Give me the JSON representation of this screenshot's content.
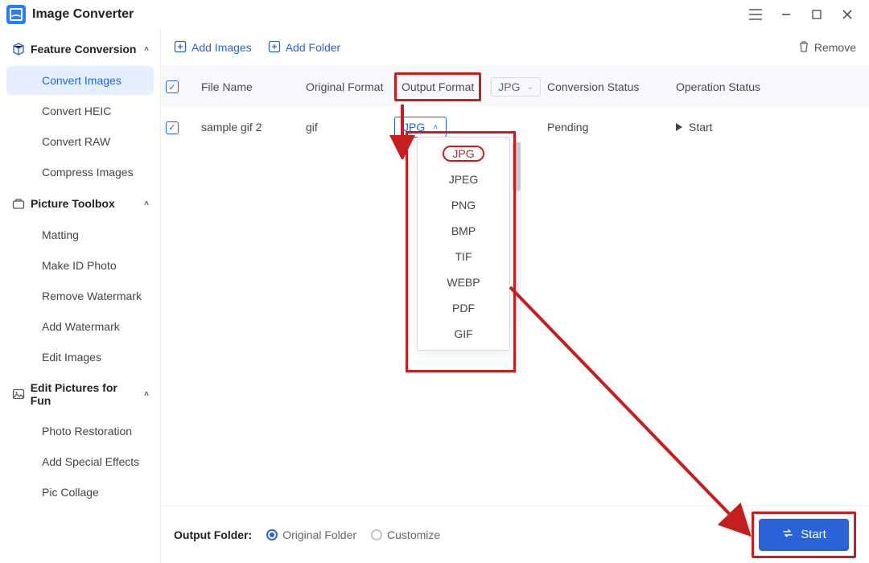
{
  "app": {
    "title": "Image Converter"
  },
  "window_controls": {
    "menu": "≡",
    "min": "—",
    "max": "▢",
    "close": "✕"
  },
  "sidebar": {
    "groups": [
      {
        "label": "Feature Conversion",
        "items": [
          {
            "label": "Convert Images",
            "active": true
          },
          {
            "label": "Convert HEIC"
          },
          {
            "label": "Convert RAW"
          },
          {
            "label": "Compress Images"
          }
        ]
      },
      {
        "label": "Picture Toolbox",
        "items": [
          {
            "label": "Matting"
          },
          {
            "label": "Make ID Photo"
          },
          {
            "label": "Remove Watermark"
          },
          {
            "label": "Add Watermark"
          },
          {
            "label": "Edit Images"
          }
        ]
      },
      {
        "label": "Edit Pictures for Fun",
        "items": [
          {
            "label": "Photo Restoration"
          },
          {
            "label": "Add Special Effects"
          },
          {
            "label": "Pic Collage"
          }
        ]
      }
    ]
  },
  "toolbar": {
    "add_images": "Add Images",
    "add_folder": "Add Folder",
    "remove": "Remove"
  },
  "table": {
    "headers": {
      "file_name": "File Name",
      "original_format": "Original Format",
      "output_format": "Output Format",
      "conversion_status": "Conversion Status",
      "operation_status": "Operation Status"
    },
    "header_output_select": "JPG",
    "rows": [
      {
        "checked": true,
        "file_name": "sample gif 2",
        "original_format": "gif",
        "output_selected": "JPG",
        "conversion_status": "Pending",
        "operation_label": "Start"
      }
    ],
    "dropdown_options": [
      "JPG",
      "JPEG",
      "PNG",
      "BMP",
      "TIF",
      "WEBP",
      "PDF",
      "GIF"
    ]
  },
  "footer": {
    "label": "Output Folder:",
    "option1": "Original Folder",
    "option2": "Customize",
    "start": "Start"
  }
}
